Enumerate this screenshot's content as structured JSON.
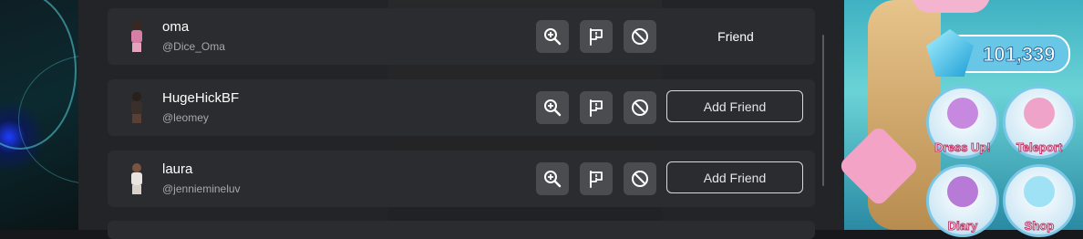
{
  "hud": {
    "gem_count": "101,339",
    "buttons": [
      {
        "label": "Dress Up!"
      },
      {
        "label": "Teleport"
      },
      {
        "label": "Diary"
      },
      {
        "label": "Shop"
      }
    ]
  },
  "players": [
    {
      "name": "oma",
      "handle": "@Dice_Oma",
      "action": "Friend",
      "is_friend": true
    },
    {
      "name": "HugeHickBF",
      "handle": "@leomey",
      "action": "Add Friend",
      "is_friend": false
    },
    {
      "name": "laura",
      "handle": "@jenniemineluv",
      "action": "Add Friend",
      "is_friend": false
    }
  ],
  "colors": {
    "row_bg": "#2b2c2f",
    "icon_btn_bg": "#4b4c50",
    "text_primary": "#ffffff",
    "text_secondary": "#a7a8ab"
  },
  "icons": {
    "inspect": "zoom-in-icon",
    "report": "flag-icon",
    "block": "block-icon"
  }
}
